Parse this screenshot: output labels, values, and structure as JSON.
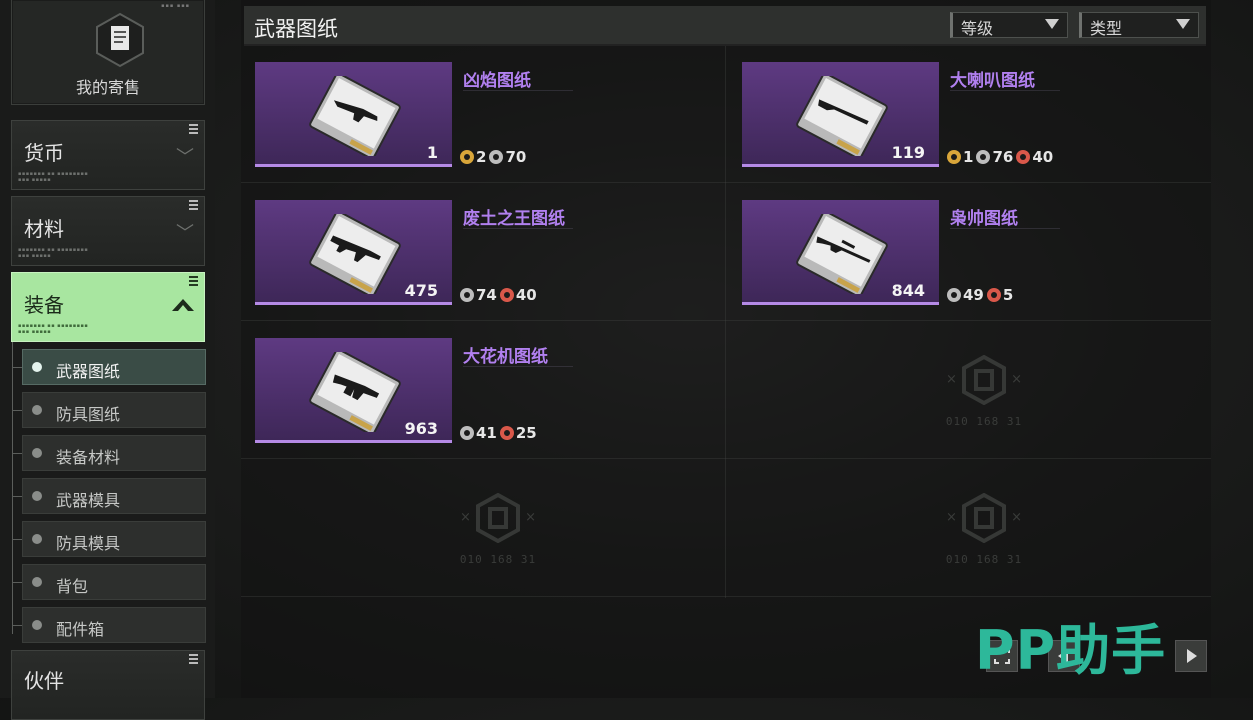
{
  "sidebar": {
    "consign_label": "我的寄售",
    "categories": [
      {
        "label": "货币"
      },
      {
        "label": "材料"
      },
      {
        "label": "装备"
      },
      {
        "label": "伙伴"
      }
    ],
    "subitems": [
      {
        "label": "武器图纸"
      },
      {
        "label": "防具图纸"
      },
      {
        "label": "装备材料"
      },
      {
        "label": "武器模具"
      },
      {
        "label": "防具模具"
      },
      {
        "label": "背包"
      },
      {
        "label": "配件箱"
      }
    ]
  },
  "header": {
    "title": "武器图纸",
    "filter_level": "等级",
    "filter_type": "类型"
  },
  "items": [
    {
      "name": "凶焰图纸",
      "count": "1",
      "reqs": [
        {
          "color": "#d9a63a",
          "value": "2"
        },
        {
          "color": "#bdbdbd",
          "value": "70"
        }
      ]
    },
    {
      "name": "大喇叭图纸",
      "count": "119",
      "reqs": [
        {
          "color": "#d9a63a",
          "value": "1"
        },
        {
          "color": "#bdbdbd",
          "value": "76"
        },
        {
          "color": "#d9584a",
          "value": "40"
        }
      ]
    },
    {
      "name": "废土之王图纸",
      "count": "475",
      "reqs": [
        {
          "color": "#bdbdbd",
          "value": "74"
        },
        {
          "color": "#d9584a",
          "value": "40"
        }
      ]
    },
    {
      "name": "枭帅图纸",
      "count": "844",
      "reqs": [
        {
          "color": "#bdbdbd",
          "value": "49"
        },
        {
          "color": "#d9584a",
          "value": "5"
        }
      ]
    },
    {
      "name": "大花机图纸",
      "count": "963",
      "reqs": [
        {
          "color": "#bdbdbd",
          "value": "41"
        },
        {
          "color": "#d9584a",
          "value": "25"
        }
      ]
    }
  ],
  "empty_code": "010 168 31",
  "watermark": "PP助手",
  "colors": {
    "accent_green": "#a8e6a0",
    "item_name_purple": "#b180ef",
    "thumb_purple": "#5e3a82"
  }
}
